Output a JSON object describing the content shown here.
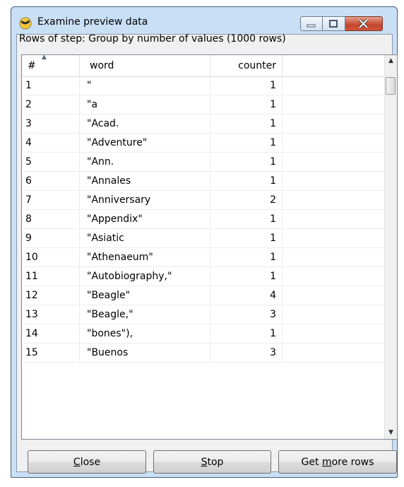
{
  "window": {
    "title": "Examine preview data",
    "icon": "kettle-app-icon"
  },
  "rows_label": "Rows of step: Group by number of values (1000 rows)",
  "table": {
    "columns": [
      "#",
      "word",
      "counter",
      ""
    ],
    "sort_column": "#",
    "rows": [
      {
        "idx": "1",
        "word": "\"",
        "counter": "1"
      },
      {
        "idx": "2",
        "word": "\"a",
        "counter": "1"
      },
      {
        "idx": "3",
        "word": "\"Acad.",
        "counter": "1"
      },
      {
        "idx": "4",
        "word": "\"Adventure\"",
        "counter": "1"
      },
      {
        "idx": "5",
        "word": "\"Ann.",
        "counter": "1"
      },
      {
        "idx": "6",
        "word": "\"Annales",
        "counter": "1"
      },
      {
        "idx": "7",
        "word": "\"Anniversary",
        "counter": "2"
      },
      {
        "idx": "8",
        "word": "\"Appendix\"",
        "counter": "1"
      },
      {
        "idx": "9",
        "word": "\"Asiatic",
        "counter": "1"
      },
      {
        "idx": "10",
        "word": "\"Athenaeum\"",
        "counter": "1"
      },
      {
        "idx": "11",
        "word": "\"Autobiography,\"",
        "counter": "1"
      },
      {
        "idx": "12",
        "word": "\"Beagle\"",
        "counter": "4"
      },
      {
        "idx": "13",
        "word": "\"Beagle,\"",
        "counter": "3"
      },
      {
        "idx": "14",
        "word": "\"bones\"),",
        "counter": "1"
      },
      {
        "idx": "15",
        "word": "\"Buenos",
        "counter": "3"
      }
    ]
  },
  "buttons": {
    "close": {
      "pre": "",
      "mnemonic": "C",
      "post": "lose"
    },
    "stop": {
      "pre": "",
      "mnemonic": "S",
      "post": "top"
    },
    "more": {
      "pre": "Get ",
      "mnemonic": "m",
      "post": "ore rows"
    }
  },
  "colors": {
    "frame": "#c9dff5",
    "close_button": "#c4442a"
  }
}
